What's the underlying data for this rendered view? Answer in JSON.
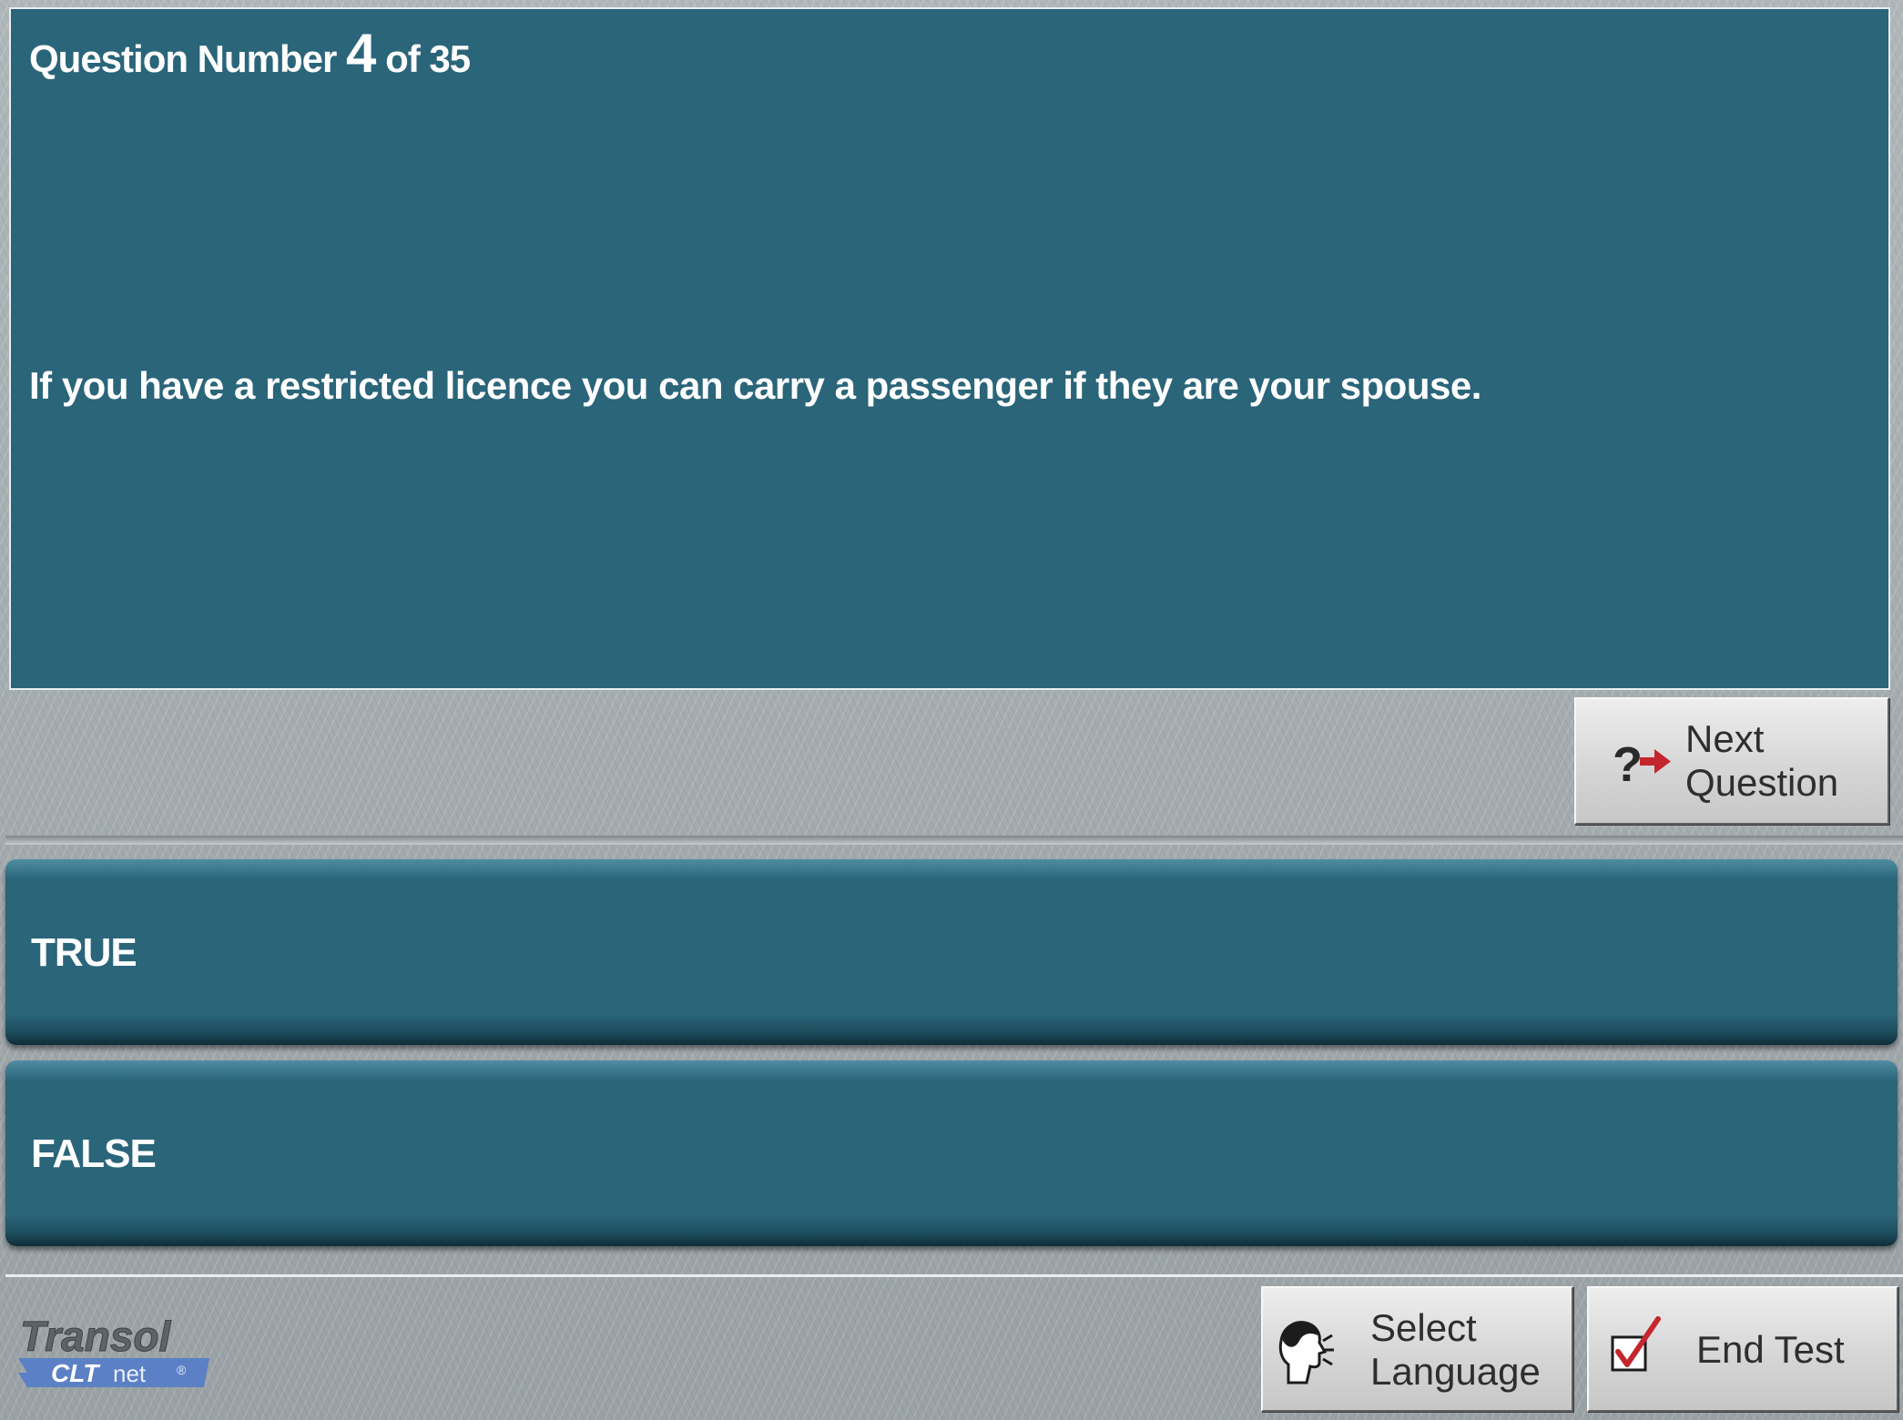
{
  "header": {
    "counter_prefix": "Question Number",
    "current_number": "4",
    "counter_suffix": "of 35"
  },
  "question": {
    "text": "If you have a restricted licence you can carry a passenger if they are your spouse."
  },
  "answers": [
    {
      "label": "TRUE"
    },
    {
      "label": "FALSE"
    }
  ],
  "next_button": {
    "line1": "Next",
    "line2": "Question",
    "icon": "question-arrow-icon"
  },
  "footer": {
    "select_language": {
      "line1": "Select",
      "line2": "Language",
      "icon": "speaking-head-icon"
    },
    "end_test": {
      "label": "End Test",
      "icon": "checkbox-check-icon"
    },
    "logo": {
      "brand": "Transol",
      "sub_bold": "CLT",
      "sub_light": "net",
      "mark": "®"
    }
  },
  "colors": {
    "panel": "#2a657a",
    "answer_bar": "#2a657a",
    "background": "#a3aaae",
    "accent_red": "#c4262e",
    "logo_blue": "#5b80c6"
  }
}
